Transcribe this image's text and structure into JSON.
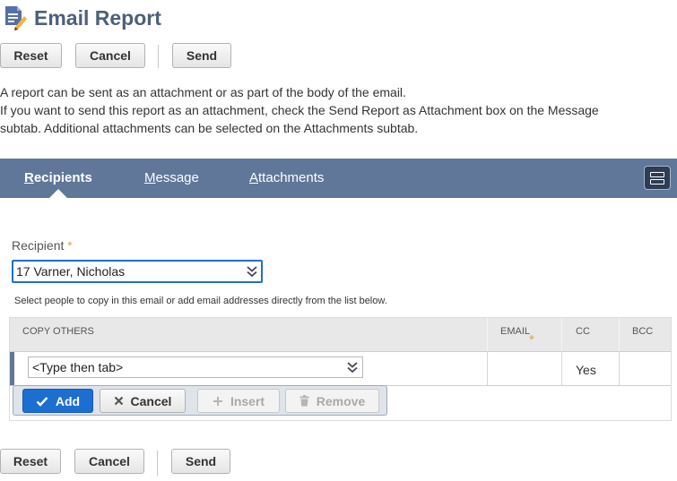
{
  "header": {
    "title": "Email Report",
    "icon": "document-edit-icon"
  },
  "toolbar_top": {
    "reset": "Reset",
    "cancel": "Cancel",
    "send": "Send"
  },
  "description": {
    "line1": "A report can be sent as an attachment or as part of the body of the email.",
    "line2": "If you want to send this report as an attachment, check the Send Report as Attachment box on the Message",
    "line3": "subtab. Additional attachments can be selected on the Attachments subtab."
  },
  "tabs": [
    {
      "prefix": "",
      "accel": "R",
      "rest": "ecipients",
      "active": true
    },
    {
      "prefix": "",
      "accel": "M",
      "rest": "essage",
      "active": false
    },
    {
      "prefix": "",
      "accel": "A",
      "rest": "ttachments",
      "active": false
    }
  ],
  "recipient": {
    "label": "Recipient",
    "required_mark": "*",
    "value": "17 Varner, Nicholas"
  },
  "hint": "Select people to copy in this email or add email addresses directly from the list below.",
  "copy_table": {
    "headers": {
      "copy_others": "COPY OTHERS",
      "email": "EMAIL",
      "email_required": "*",
      "cc": "CC",
      "bcc": "BCC"
    },
    "row": {
      "placeholder": "<Type then tab>",
      "cc": "Yes",
      "bcc": ""
    },
    "actions": {
      "add": "Add",
      "cancel": "Cancel",
      "insert": "Insert",
      "remove": "Remove"
    }
  },
  "toolbar_bottom": {
    "reset": "Reset",
    "cancel": "Cancel",
    "send": "Send"
  },
  "colors": {
    "title": "#4d5f79",
    "tabbar": "#607799",
    "accent": "#1c6fd1",
    "required": "#e4a23a"
  }
}
